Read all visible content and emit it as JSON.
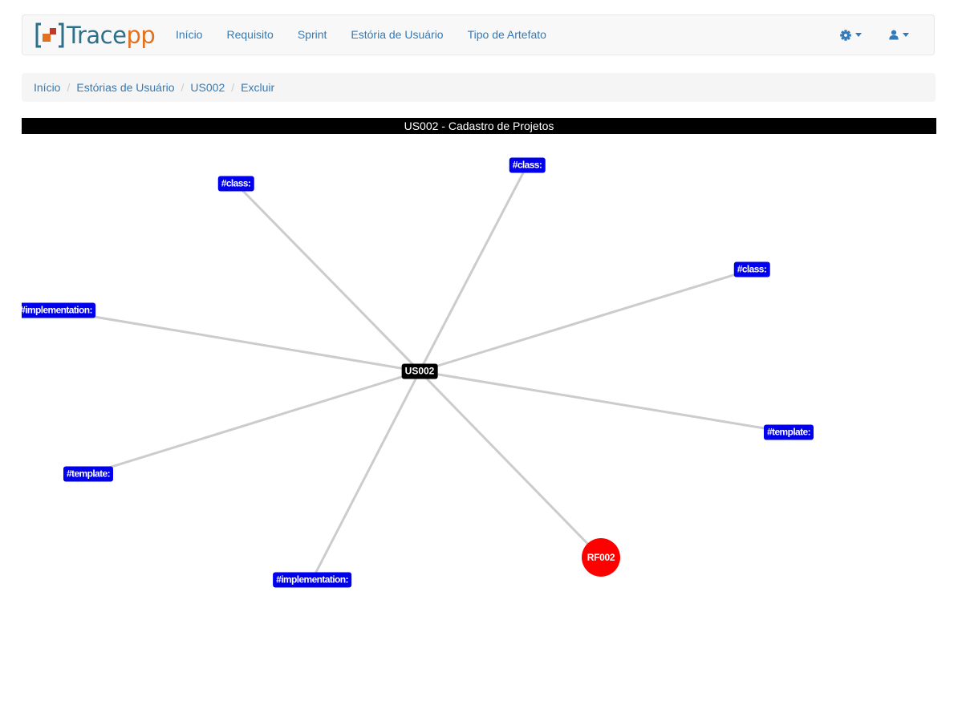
{
  "brand": {
    "part1": "Trace",
    "part2": "pp",
    "logo_icon": "bracket-squares-logo"
  },
  "nav": {
    "links": [
      "Início",
      "Requisito",
      "Sprint",
      "Estória de Usuário",
      "Tipo de Artefato"
    ],
    "settings_icon": "gear-icon",
    "user_icon": "user-icon"
  },
  "breadcrumb": [
    "Início",
    "Estórias de Usuário",
    "US002",
    "Excluir"
  ],
  "graph": {
    "title": "US002 - Cadastro de Projetos",
    "center": "US002",
    "nodes": [
      {
        "label": "#class:",
        "color": "#0000ee"
      },
      {
        "label": "#class:",
        "color": "#0000ee"
      },
      {
        "label": "#class:",
        "color": "#0000ee"
      },
      {
        "label": "#implementation:",
        "color": "#0000ee"
      },
      {
        "label": "#template:",
        "color": "#0000ee"
      },
      {
        "label": "#template:",
        "color": "#0000ee"
      },
      {
        "label": "#implementation:",
        "color": "#0000ee"
      },
      {
        "label": "RF002",
        "color": "#ff0000"
      }
    ],
    "edge_color": "#cccccc"
  }
}
